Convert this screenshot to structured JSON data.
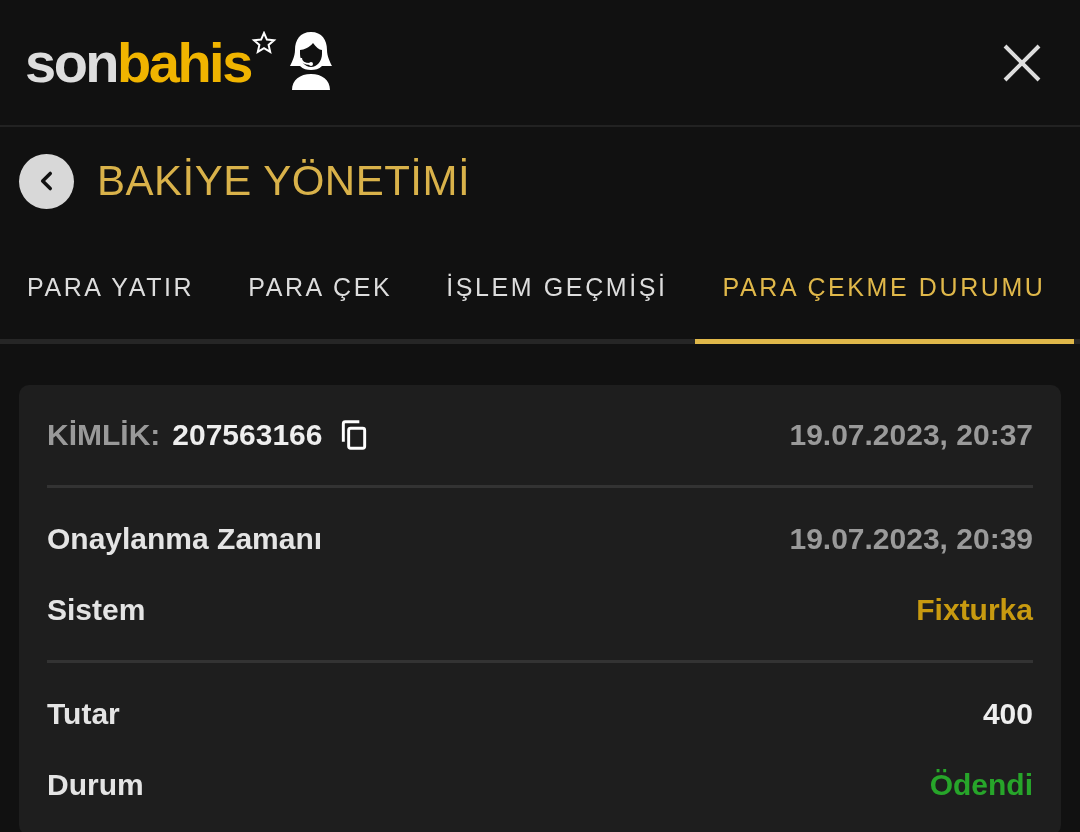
{
  "header": {
    "logo_left": "son",
    "logo_right": "bahis"
  },
  "page": {
    "title": "BAKİYE YÖNETİMİ"
  },
  "tabs": [
    {
      "label": "PARA YATIR",
      "selected": false
    },
    {
      "label": "PARA ÇEK",
      "selected": false
    },
    {
      "label": "İŞLEM GEÇMİŞİ",
      "selected": false
    },
    {
      "label": "PARA ÇEKME DURUMU",
      "selected": true
    }
  ],
  "card": {
    "id_label": "KİMLİK:",
    "id": "207563166",
    "time": "19.07.2023, 20:37",
    "groups": [
      [
        {
          "label": "Onaylanma Zamanı",
          "value": "19.07.2023, 20:39",
          "color": "#9a9a9a"
        },
        {
          "label": "Sistem",
          "value": "Fixturka",
          "color": "#c89a10"
        }
      ],
      [
        {
          "label": "Tutar",
          "value": "400",
          "color": "#eeeeee"
        },
        {
          "label": "Durum",
          "value": "Ödendi",
          "color": "#27a52a"
        }
      ]
    ]
  }
}
